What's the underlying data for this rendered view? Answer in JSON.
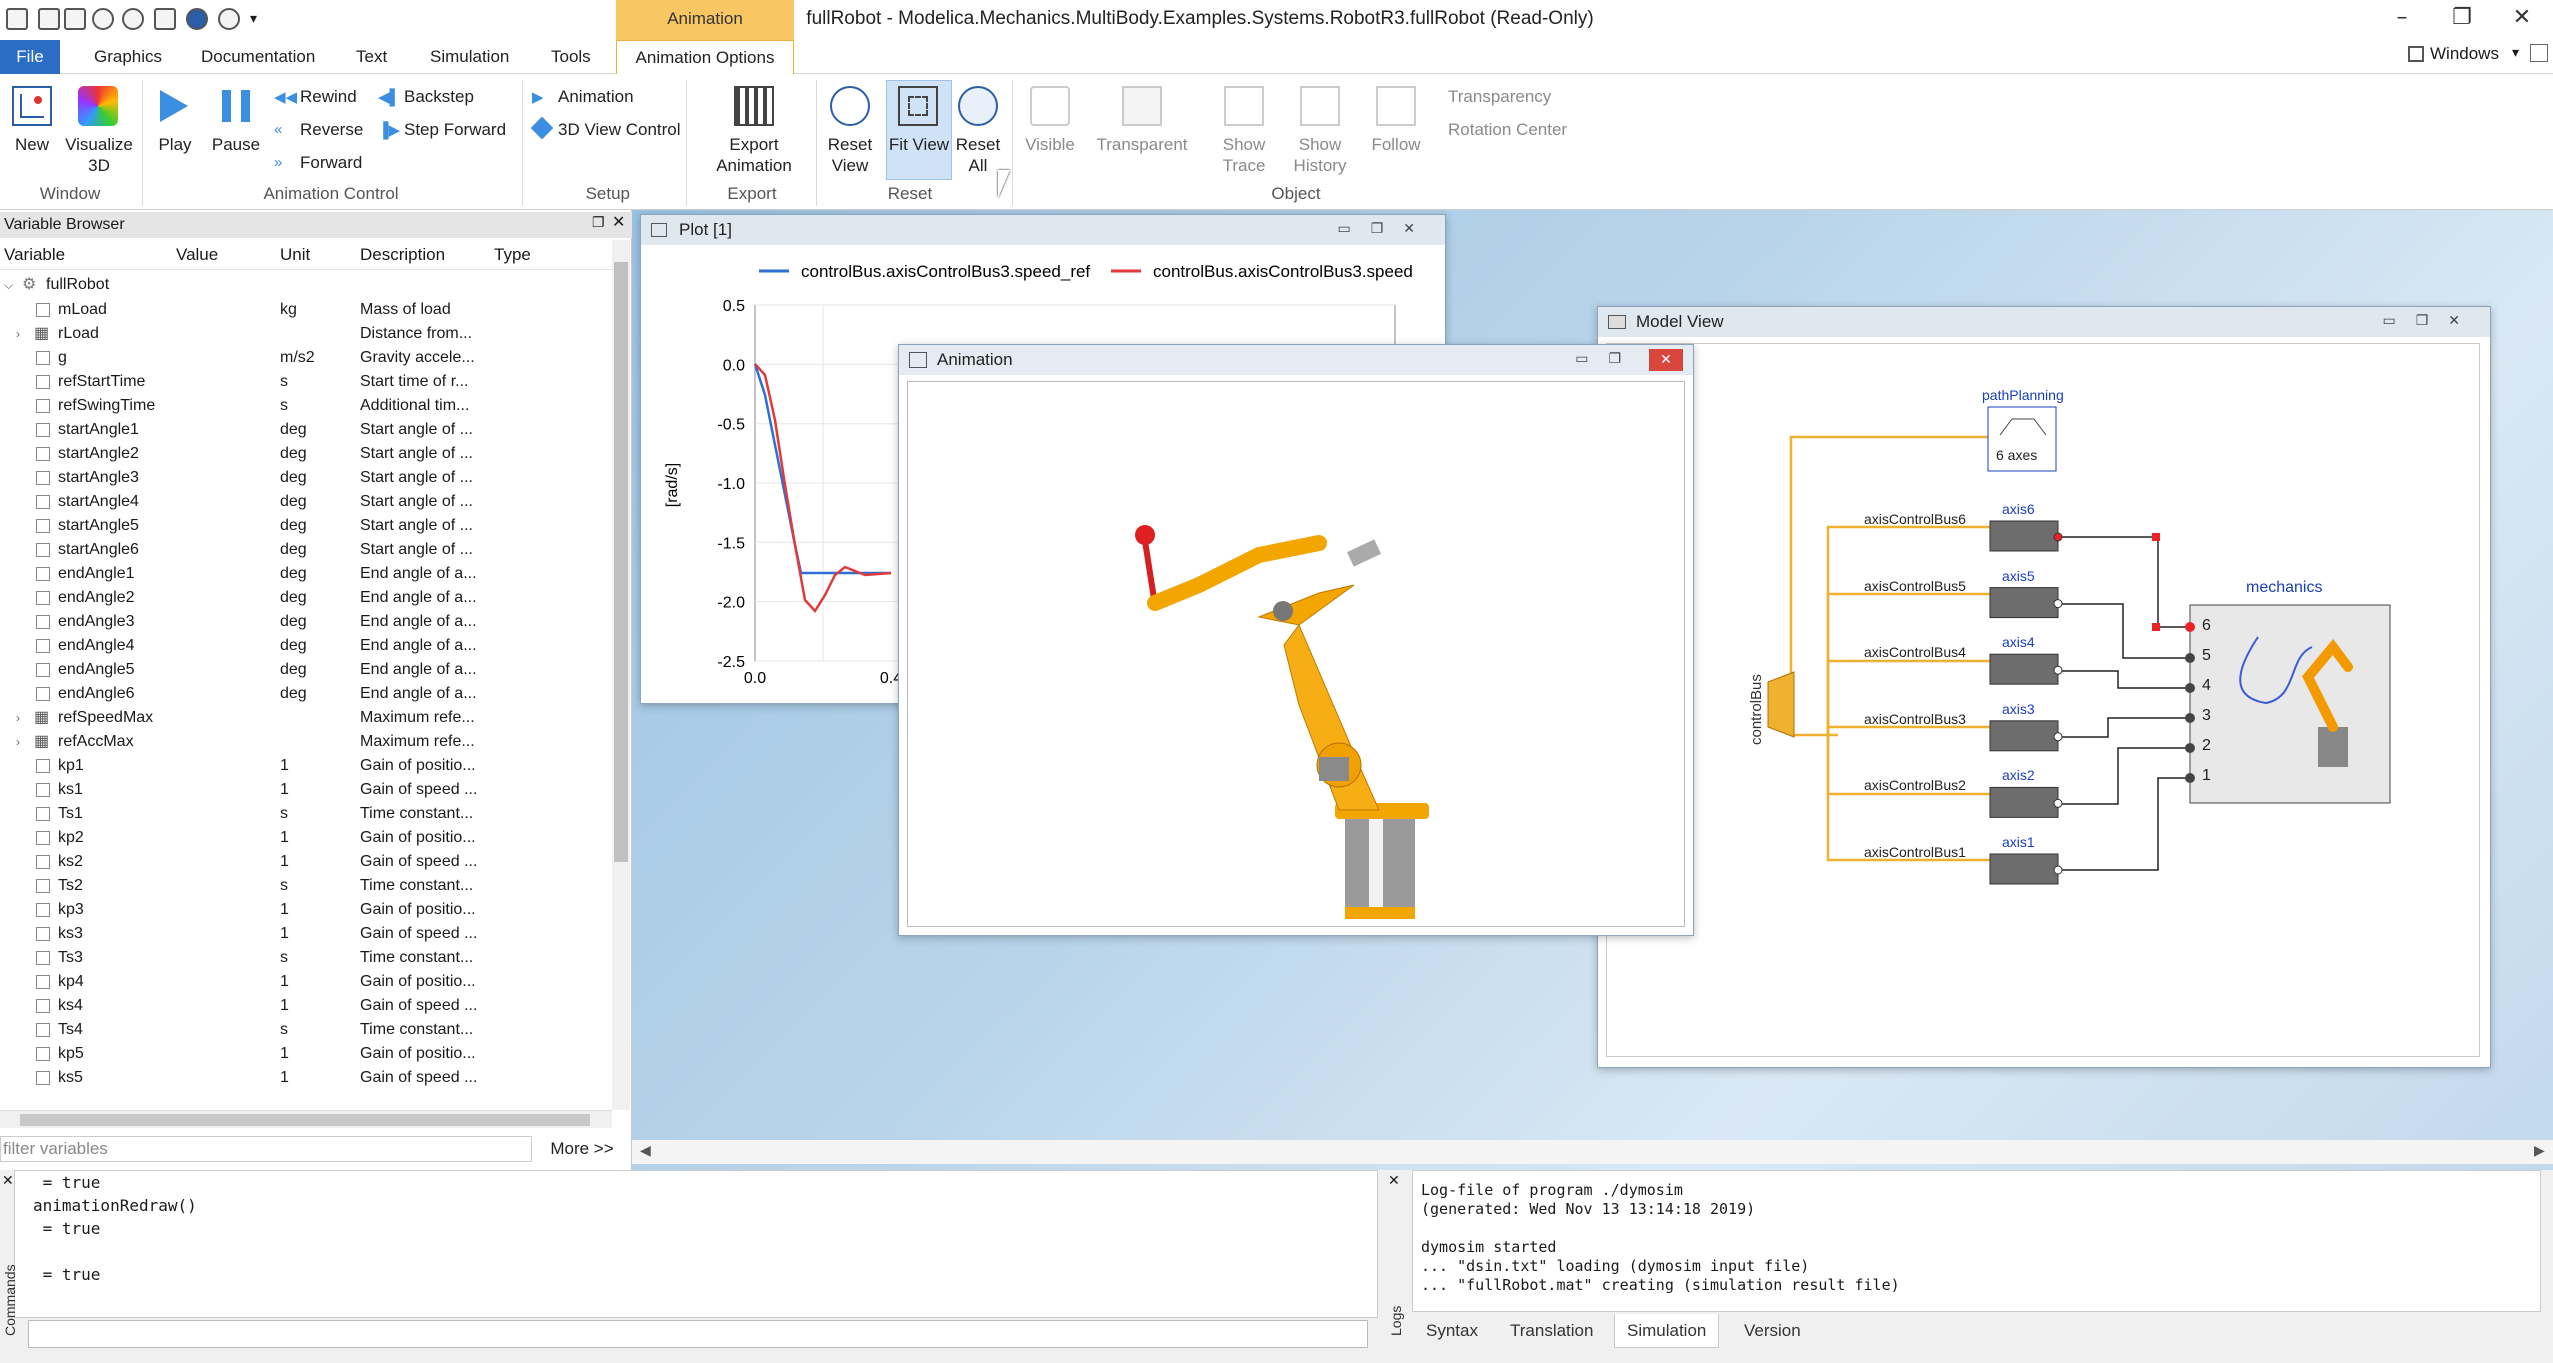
{
  "window": {
    "title": "fullRobot - Modelica.Mechanics.MultiBody.Examples.Systems.RobotR3.fullRobot  (Read-Only)",
    "context_tab": "Animation",
    "windows_label": "Windows"
  },
  "tabs": [
    "File",
    "Graphics",
    "Documentation",
    "Text",
    "Simulation",
    "Tools",
    "Animation Options"
  ],
  "ribbon": {
    "window_group": {
      "title": "Window",
      "new": "New",
      "visualize": "Visualize\n3D"
    },
    "anim_control": {
      "title": "Animation Control",
      "play": "Play",
      "pause": "Pause",
      "rewind": "Rewind",
      "reverse": "Reverse",
      "forward": "Forward",
      "backstep": "Backstep",
      "step_forward": "Step Forward"
    },
    "setup": {
      "title": "Setup",
      "animation": "Animation",
      "view_control": "3D View Control"
    },
    "export": {
      "title": "Export",
      "export_animation": "Export\nAnimation"
    },
    "reset": {
      "title": "Reset",
      "reset_view": "Reset\nView",
      "fit_view": "Fit View",
      "reset_all": "Reset\nAll"
    },
    "object": {
      "title": "Object",
      "visible": "Visible",
      "transparent": "Transparent",
      "show_trace": "Show\nTrace",
      "show_history": "Show\nHistory",
      "follow": "Follow",
      "transparency": "Transparency",
      "rotation_center": "Rotation Center"
    }
  },
  "variable_browser": {
    "title": "Variable Browser",
    "columns": [
      "Variable",
      "Value",
      "Unit",
      "Description",
      "Type"
    ],
    "root": "fullRobot",
    "rows": [
      {
        "name": "mLoad",
        "unit": "kg",
        "desc": "Mass of load",
        "kind": "cb"
      },
      {
        "name": "rLoad",
        "unit": "",
        "desc": "Distance from...",
        "kind": "grp"
      },
      {
        "name": "g",
        "unit": "m/s2",
        "desc": "Gravity accele...",
        "kind": "cb"
      },
      {
        "name": "refStartTime",
        "unit": "s",
        "desc": "Start time of r...",
        "kind": "cb"
      },
      {
        "name": "refSwingTime",
        "unit": "s",
        "desc": "Additional tim...",
        "kind": "cb"
      },
      {
        "name": "startAngle1",
        "unit": "deg",
        "desc": "Start angle of ...",
        "kind": "cb"
      },
      {
        "name": "startAngle2",
        "unit": "deg",
        "desc": "Start angle of ...",
        "kind": "cb"
      },
      {
        "name": "startAngle3",
        "unit": "deg",
        "desc": "Start angle of ...",
        "kind": "cb"
      },
      {
        "name": "startAngle4",
        "unit": "deg",
        "desc": "Start angle of ...",
        "kind": "cb"
      },
      {
        "name": "startAngle5",
        "unit": "deg",
        "desc": "Start angle of ...",
        "kind": "cb"
      },
      {
        "name": "startAngle6",
        "unit": "deg",
        "desc": "Start angle of ...",
        "kind": "cb"
      },
      {
        "name": "endAngle1",
        "unit": "deg",
        "desc": "End angle of a...",
        "kind": "cb"
      },
      {
        "name": "endAngle2",
        "unit": "deg",
        "desc": "End angle of a...",
        "kind": "cb"
      },
      {
        "name": "endAngle3",
        "unit": "deg",
        "desc": "End angle of a...",
        "kind": "cb"
      },
      {
        "name": "endAngle4",
        "unit": "deg",
        "desc": "End angle of a...",
        "kind": "cb"
      },
      {
        "name": "endAngle5",
        "unit": "deg",
        "desc": "End angle of a...",
        "kind": "cb"
      },
      {
        "name": "endAngle6",
        "unit": "deg",
        "desc": "End angle of a...",
        "kind": "cb"
      },
      {
        "name": "refSpeedMax",
        "unit": "",
        "desc": "Maximum refe...",
        "kind": "grp"
      },
      {
        "name": "refAccMax",
        "unit": "",
        "desc": "Maximum refe...",
        "kind": "grp"
      },
      {
        "name": "kp1",
        "unit": "1",
        "desc": "Gain of positio...",
        "kind": "cb"
      },
      {
        "name": "ks1",
        "unit": "1",
        "desc": "Gain of speed ...",
        "kind": "cb"
      },
      {
        "name": "Ts1",
        "unit": "s",
        "desc": "Time constant...",
        "kind": "cb"
      },
      {
        "name": "kp2",
        "unit": "1",
        "desc": "Gain of positio...",
        "kind": "cb"
      },
      {
        "name": "ks2",
        "unit": "1",
        "desc": "Gain of speed ...",
        "kind": "cb"
      },
      {
        "name": "Ts2",
        "unit": "s",
        "desc": "Time constant...",
        "kind": "cb"
      },
      {
        "name": "kp3",
        "unit": "1",
        "desc": "Gain of positio...",
        "kind": "cb"
      },
      {
        "name": "ks3",
        "unit": "1",
        "desc": "Gain of speed ...",
        "kind": "cb"
      },
      {
        "name": "Ts3",
        "unit": "s",
        "desc": "Time constant...",
        "kind": "cb"
      },
      {
        "name": "kp4",
        "unit": "1",
        "desc": "Gain of positio...",
        "kind": "cb"
      },
      {
        "name": "ks4",
        "unit": "1",
        "desc": "Gain of speed ...",
        "kind": "cb"
      },
      {
        "name": "Ts4",
        "unit": "s",
        "desc": "Time constant...",
        "kind": "cb"
      },
      {
        "name": "kp5",
        "unit": "1",
        "desc": "Gain of positio...",
        "kind": "cb"
      },
      {
        "name": "ks5",
        "unit": "1",
        "desc": "Gain of speed ...",
        "kind": "cb"
      }
    ],
    "filter_placeholder": "filter variables",
    "more": "More >>"
  },
  "plot": {
    "title": "Plot [1]",
    "legend": [
      "controlBus.axisControlBus3.speed_ref",
      "controlBus.axisControlBus3.speed"
    ],
    "ylabel": "[rad/s]",
    "yticks": [
      "0.5",
      "0.0",
      "-0.5",
      "-1.0",
      "-1.5",
      "-2.0",
      "-2.5"
    ],
    "xticks": [
      "0.0",
      "0.4"
    ],
    "colors": {
      "ref": "#2e6fd8",
      "speed": "#e03a3a"
    }
  },
  "animation": {
    "title": "Animation"
  },
  "model": {
    "title": "Model View",
    "path_planning": "pathPlanning",
    "path_axes": "6 axes",
    "control_bus": "controlBus",
    "mechanics": "mechanics",
    "axes": [
      "axis6",
      "axis5",
      "axis4",
      "axis3",
      "axis2",
      "axis1"
    ],
    "buses": [
      "axisControlBus6",
      "axisControlBus5",
      "axisControlBus4",
      "axisControlBus3",
      "axisControlBus2",
      "axisControlBus1"
    ],
    "ports": [
      "6",
      "5",
      "4",
      "3",
      "2",
      "1"
    ]
  },
  "commands": {
    "lines": " = true\nanimationRedraw()\n = true\n\n = true",
    "side_label": "Commands"
  },
  "log": {
    "lines": "Log-file of program ./dymosim\n(generated: Wed Nov 13 13:14:18 2019)\n\ndymosim started\n... \"dsin.txt\" loading (dymosim input file)\n... \"fullRobot.mat\" creating (simulation result file)",
    "side_label": "Logs",
    "tabs": [
      "Syntax",
      "Translation",
      "Simulation",
      "Version"
    ]
  }
}
